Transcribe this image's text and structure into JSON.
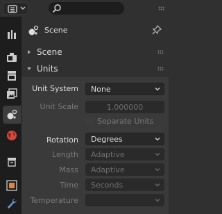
{
  "header": {
    "search_placeholder": ""
  },
  "context": {
    "title": "Scene"
  },
  "panels": {
    "scene": {
      "label": "Scene"
    },
    "units": {
      "label": "Units"
    }
  },
  "units": {
    "unit_system": {
      "label": "Unit System",
      "value": "None"
    },
    "unit_scale": {
      "label": "Unit Scale",
      "value": "1.000000"
    },
    "separate_units": {
      "label": "Separate Units"
    },
    "rotation": {
      "label": "Rotation",
      "value": "Degrees"
    },
    "length": {
      "label": "Length",
      "value": "Adaptive"
    },
    "mass": {
      "label": "Mass",
      "value": "Adaptive"
    },
    "time": {
      "label": "Time",
      "value": "Seconds"
    },
    "temperature": {
      "label": "Temperature",
      "value": ""
    }
  },
  "sidebar": {
    "tabs": [
      "tool-icon",
      "render-icon",
      "output-icon",
      "view-layer-icon",
      "scene-icon",
      "world-icon",
      "collection-icon",
      "object-icon",
      "modifier-icon"
    ],
    "active_tab": "scene-icon"
  },
  "colors": {
    "background": "#303030",
    "sidebar": "#1d1d1d",
    "field": "#282828",
    "object_orange": "#e8843a",
    "world_red": "#d8463c",
    "modifier_blue": "#6b9bd8"
  }
}
